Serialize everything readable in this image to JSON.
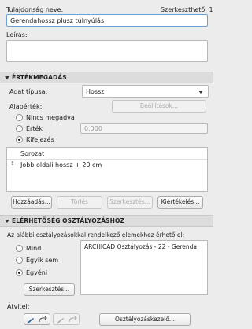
{
  "header": {
    "name_label": "Tulajdonság neve:",
    "editable_label": "Szerkeszthető:",
    "editable_count": "1",
    "name_value": "Gerendahossz  plusz túlnyúlás",
    "description_label": "Leírás:",
    "description_value": ""
  },
  "value_section": {
    "title": "ÉRTÉKMEGADÁS",
    "data_type_label": "Adat típusa:",
    "data_type_value": "Hossz",
    "default_label": "Alapérték:",
    "settings_button": "Beállítások...",
    "options": [
      {
        "label": "Nincs megadva",
        "selected": false
      },
      {
        "label": "Érték",
        "selected": false,
        "value": "0,000"
      },
      {
        "label": "Kifejezés",
        "selected": true
      }
    ],
    "table_header": "Sorozat",
    "table_rows": [
      "Jobb oldali hossz + 20 cm"
    ],
    "buttons": {
      "add": "Hozzáadás...",
      "delete": "Törlés",
      "edit": "Szerkesztés...",
      "evaluate": "Kiértékelés..."
    }
  },
  "classification_section": {
    "title": "ELÉRHETŐSÉG OSZTÁLYOZÁSHOZ",
    "description": "Az alábbi osztályozásokkal rendelkező elemekhez érhető el:",
    "options": [
      {
        "label": "Mind",
        "selected": false
      },
      {
        "label": "Egyik sem",
        "selected": false
      },
      {
        "label": "Egyéni",
        "selected": true
      }
    ],
    "classifications": [
      "ARCHICAD Osztályozás - 22 - Gerenda"
    ],
    "edit_button": "Szerkesztés...",
    "transfer_label": "Átvitel:",
    "manager_button": "Osztályozáskezelő..."
  }
}
